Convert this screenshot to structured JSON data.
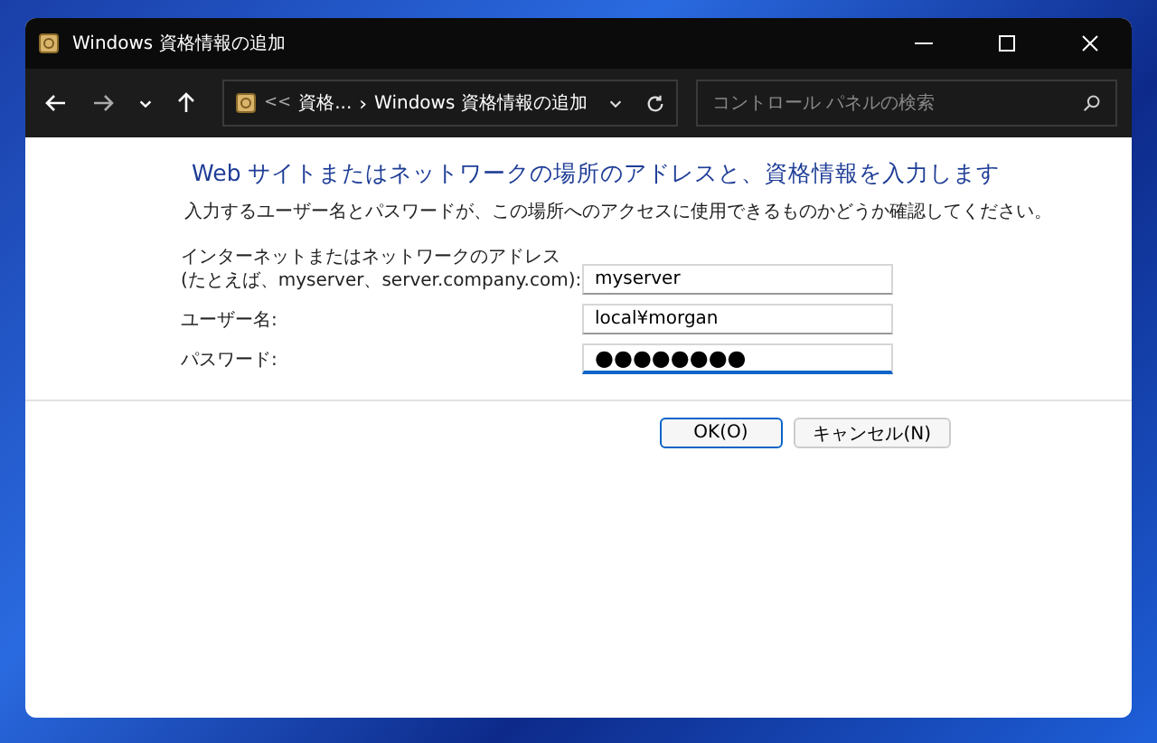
{
  "window": {
    "title": "Windows 資格情報の追加"
  },
  "nav": {
    "breadcrumb_overflow": "<<",
    "breadcrumb": [
      "資格...",
      "Windows 資格情報の追加"
    ],
    "separator": "›",
    "search": {
      "placeholder": "コントロール パネルの検索"
    }
  },
  "form": {
    "heading": "Web サイトまたはネットワークの場所のアドレスと、資格情報を入力します",
    "description": "入力するユーザー名とパスワードが、この場所へのアクセスに使用できるものかどうか確認してください。",
    "fields": [
      {
        "label": "インターネットまたはネットワークのアドレス",
        "hint": "(たとえば、myserver、server.company.com):",
        "value": "myserver",
        "focused": false
      },
      {
        "label": "ユーザー名:",
        "value": "local¥morgan",
        "focused": false
      },
      {
        "label": "パスワード:",
        "value": "●●●●●●●●",
        "focused": true
      }
    ]
  },
  "buttons": [
    {
      "label": "OK(O)",
      "default": true
    },
    {
      "label": "キャンセル(N)",
      "default": false
    }
  ]
}
